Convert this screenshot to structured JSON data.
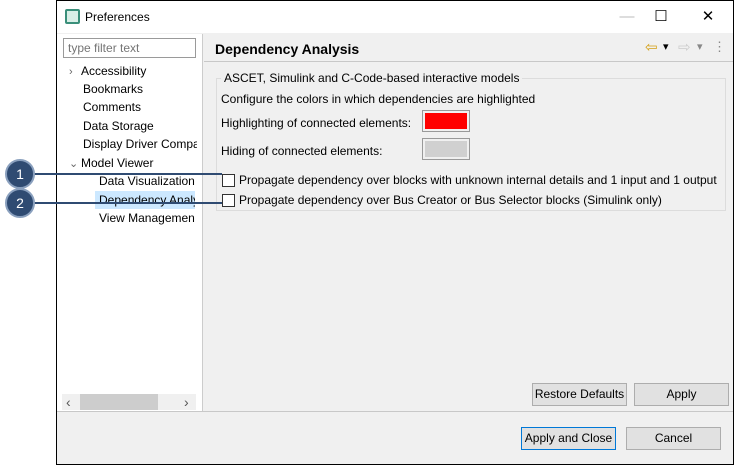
{
  "window": {
    "title": "Preferences",
    "minimize": "—",
    "maximize": "☐",
    "close": "✕"
  },
  "sidebar": {
    "filter_placeholder": "type filter text",
    "items": [
      {
        "label": "Accessibility",
        "twisty": "›"
      },
      {
        "label": "Bookmarks"
      },
      {
        "label": "Comments"
      },
      {
        "label": "Data Storage"
      },
      {
        "label": "Display Driver Compa"
      },
      {
        "label": "Model Viewer",
        "twisty": "⌄"
      },
      {
        "label": "Data Visualization"
      },
      {
        "label": "Dependency Analy"
      },
      {
        "label": "View Management"
      }
    ],
    "scroll_left": "‹",
    "scroll_right": "›"
  },
  "page": {
    "title": "Dependency Analysis",
    "nav": {
      "back": "⇦",
      "forward": "⇨",
      "dropdown": "▾",
      "menu": "⋮"
    },
    "group_label": "ASCET, Simulink and C-Code-based interactive models",
    "description": "Configure the colors in which dependencies are highlighted",
    "highlight_label": "Highlighting of connected elements:",
    "highlight_color": "#ff0000",
    "hiding_label": "Hiding of connected elements:",
    "hiding_color": "#d0d0d0",
    "checkbox1": {
      "label": "Propagate dependency over blocks with unknown internal details and 1 input and 1 output",
      "checked": false
    },
    "checkbox2": {
      "label": "Propagate dependency over Bus Creator or Bus Selector blocks (Simulink only)",
      "checked": false
    },
    "restore_defaults": "Restore Defaults",
    "apply": "Apply"
  },
  "footer": {
    "apply_close": "Apply and Close",
    "cancel": "Cancel"
  },
  "callouts": [
    "1",
    "2"
  ]
}
